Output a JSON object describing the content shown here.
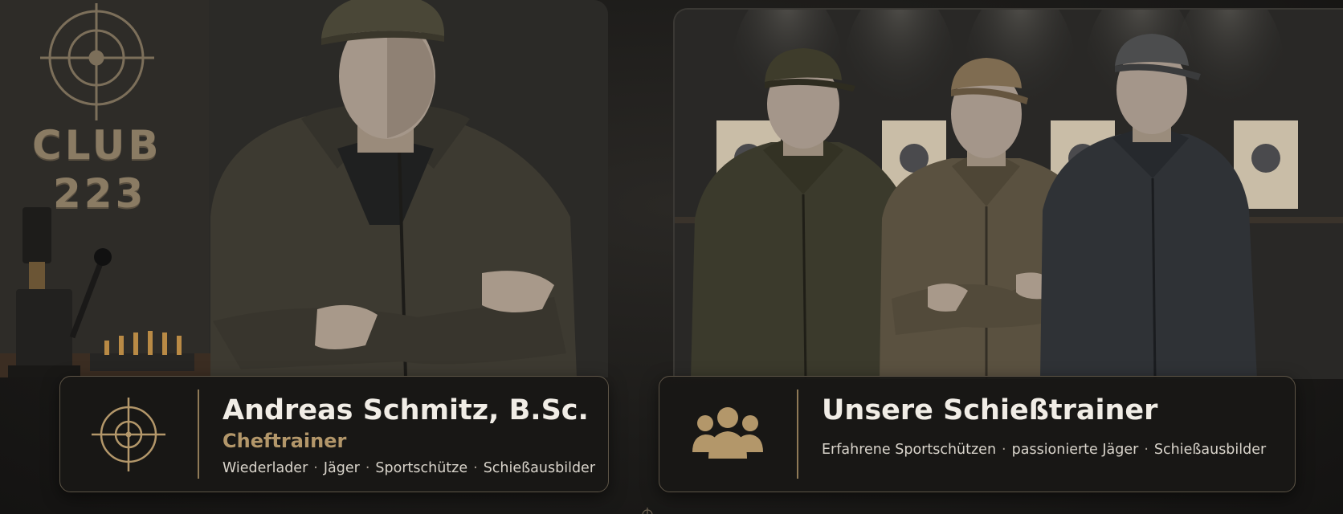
{
  "wall_sign": {
    "line1": "CLUB",
    "line2": "223"
  },
  "head_trainer": {
    "name": "Andreas Schmitz, B.Sc.",
    "role": "Cheftrainer",
    "tags": [
      "Wiederlader",
      "Jäger",
      "Sportschütze",
      "Schießausbilder"
    ],
    "icon": "crosshair-icon"
  },
  "team": {
    "title": "Unsere Schießtrainer",
    "tags": [
      "Erfahrene Sportschützen",
      "passionierte Jäger",
      "Schießausbilder"
    ],
    "icon": "group-people-icon"
  },
  "colors": {
    "accent_gold": "#b3976a",
    "card_border": "#5d5446",
    "card_bg": "#181715",
    "title_text": "#f1ede6",
    "body_text": "#d9d4cb"
  }
}
